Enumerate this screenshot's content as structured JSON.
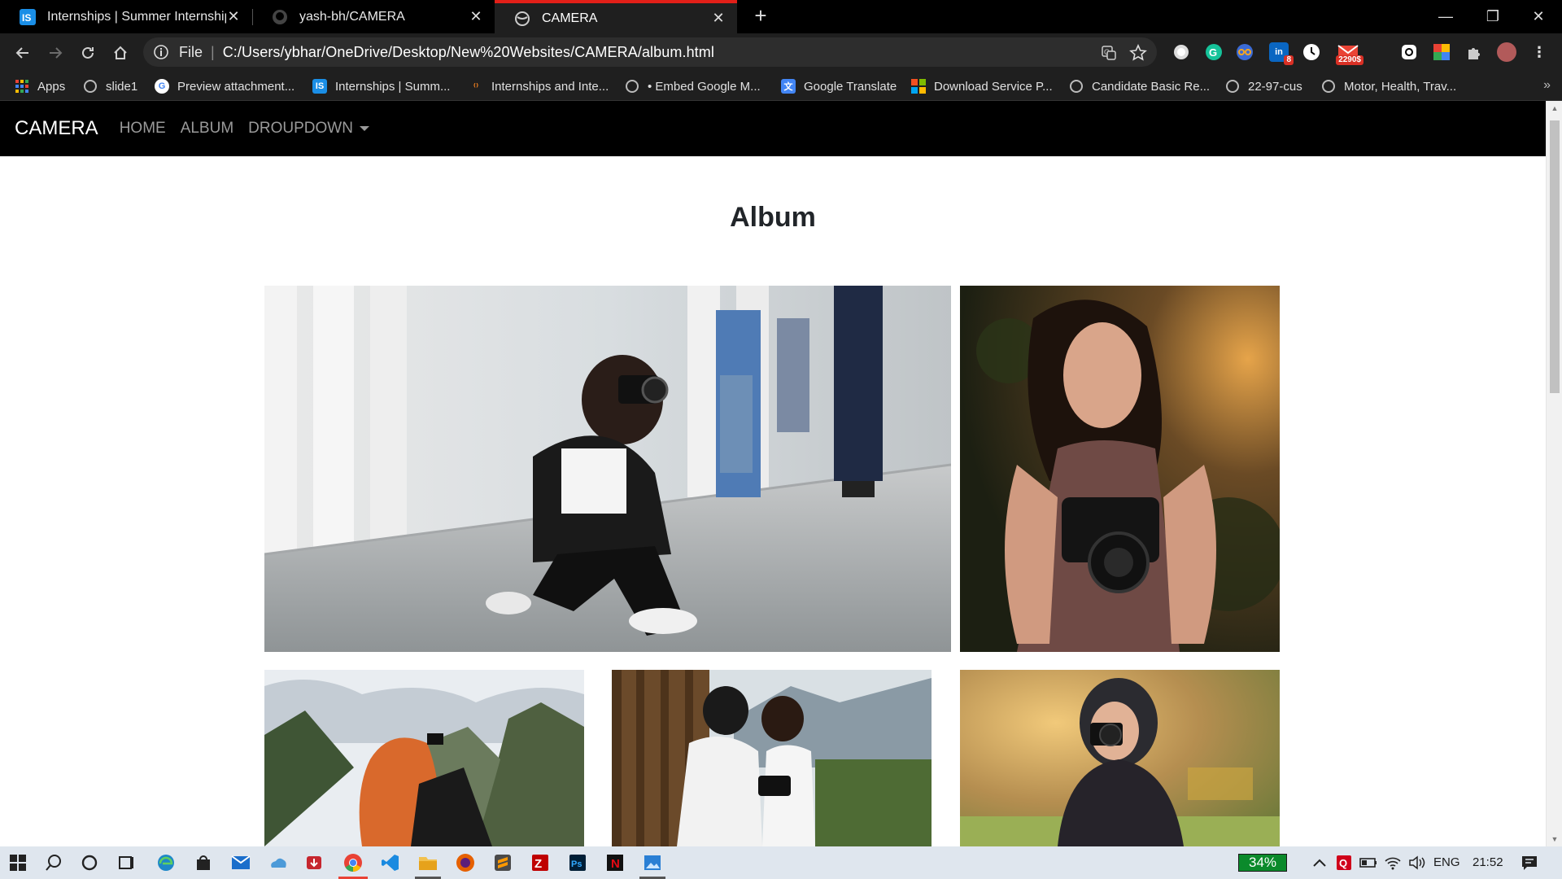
{
  "browser": {
    "tabs": [
      {
        "title": "Internships | Summer Internship",
        "icon": "internshala-icon",
        "active": false
      },
      {
        "title": "yash-bh/CAMERA",
        "icon": "github-icon",
        "active": false
      },
      {
        "title": "CAMERA",
        "icon": "globe-icon",
        "active": true
      }
    ],
    "address": {
      "scheme": "File",
      "url": "C:/Users/ybhar/OneDrive/Desktop/New%20Websites/CAMERA/album.html"
    },
    "extensions": [
      {
        "name": "circle-extension-icon"
      },
      {
        "name": "grammarly-icon"
      },
      {
        "name": "glasses-extension-icon"
      },
      {
        "name": "linkedin-icon",
        "badge": "8"
      },
      {
        "name": "clock-extension-icon"
      },
      {
        "name": "gmail-icon",
        "badge": "2290$"
      },
      {
        "name": "instagram-icon"
      },
      {
        "name": "color-extension-icon"
      },
      {
        "name": "puzzle-icon"
      },
      {
        "name": "profile-avatar-icon"
      }
    ],
    "bookmarks": [
      {
        "label": "Apps",
        "icon": "apps-grid-icon"
      },
      {
        "label": "slide1",
        "icon": "globe-icon"
      },
      {
        "label": "Preview attachment...",
        "icon": "google-icon"
      },
      {
        "label": "Internships | Summ...",
        "icon": "internshala-icon"
      },
      {
        "label": "Internships and Inte...",
        "icon": "flame-icon"
      },
      {
        "label": "• Embed Google M...",
        "icon": "globe-icon"
      },
      {
        "label": "Google Translate",
        "icon": "translate-icon"
      },
      {
        "label": "Download Service P...",
        "icon": "microsoft-icon"
      },
      {
        "label": "Candidate Basic Re...",
        "icon": "globe-icon"
      },
      {
        "label": "22-97-cus",
        "icon": "globe-icon"
      },
      {
        "label": "Motor, Health, Trav...",
        "icon": "globe-icon"
      }
    ],
    "bookmarks_more": "»"
  },
  "site": {
    "brand": "CAMERA",
    "nav": {
      "home": "HOME",
      "album": "ALBUM",
      "dropdown": "DROUPDOWN"
    },
    "page_title": "Album",
    "photos": [
      "woman-kneeling-photographer-photo",
      "woman-with-nikon-camera-photo",
      "redhead-photographer-mountains-photo",
      "couple-with-camera-photo",
      "woman-hijab-camera-photo"
    ]
  },
  "taskbar": {
    "battery": "34%",
    "language": "ENG",
    "time": "21:52",
    "accent": "#0b8a2b"
  }
}
